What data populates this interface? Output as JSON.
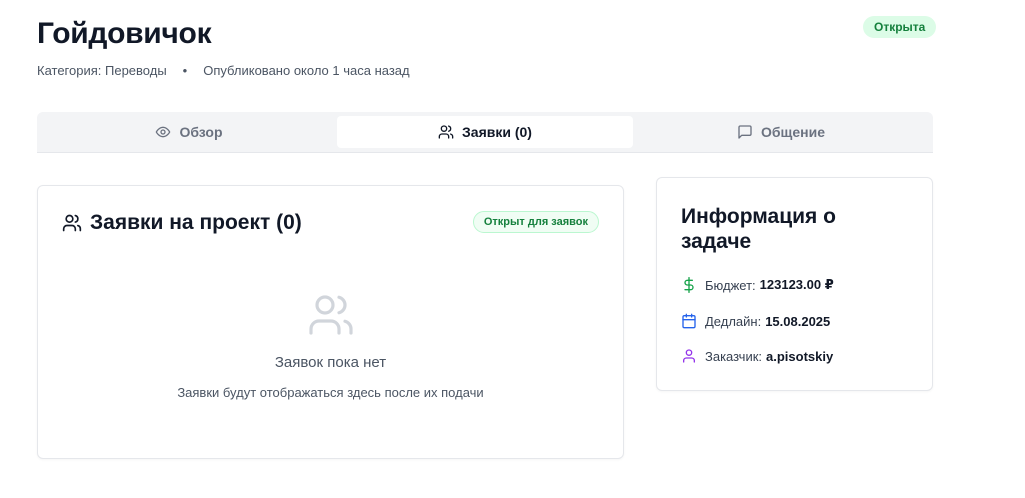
{
  "header": {
    "title": "Гойдовичок",
    "category": "Категория: Переводы",
    "separator": "•",
    "published": "Опубликовано около 1 часа назад",
    "status": "Открыта"
  },
  "tabs": [
    {
      "label": "Обзор",
      "icon": "eye-icon",
      "active": false
    },
    {
      "label": "Заявки (0)",
      "icon": "users-icon",
      "active": true
    },
    {
      "label": "Общение",
      "icon": "message-square-icon",
      "active": false
    }
  ],
  "applications": {
    "title": "Заявки на проект (0)",
    "badge": "Открыт для заявок",
    "empty_title": "Заявок пока нет",
    "empty_subtitle": "Заявки будут отображаться здесь после их подачи"
  },
  "info": {
    "title": "Информация о задаче",
    "budget_label": "Бюджет:",
    "budget_value": "123123.00 ₽",
    "deadline_label": "Дедлайн:",
    "deadline_value": "15.08.2025",
    "customer_label": "Заказчик:",
    "customer_value": "a.pisotskiy"
  },
  "colors": {
    "status_bg": "#dcfce7",
    "status_text": "#15803d",
    "budget_icon": "#16a34a",
    "deadline_icon": "#2563eb",
    "customer_icon": "#9333ea"
  }
}
